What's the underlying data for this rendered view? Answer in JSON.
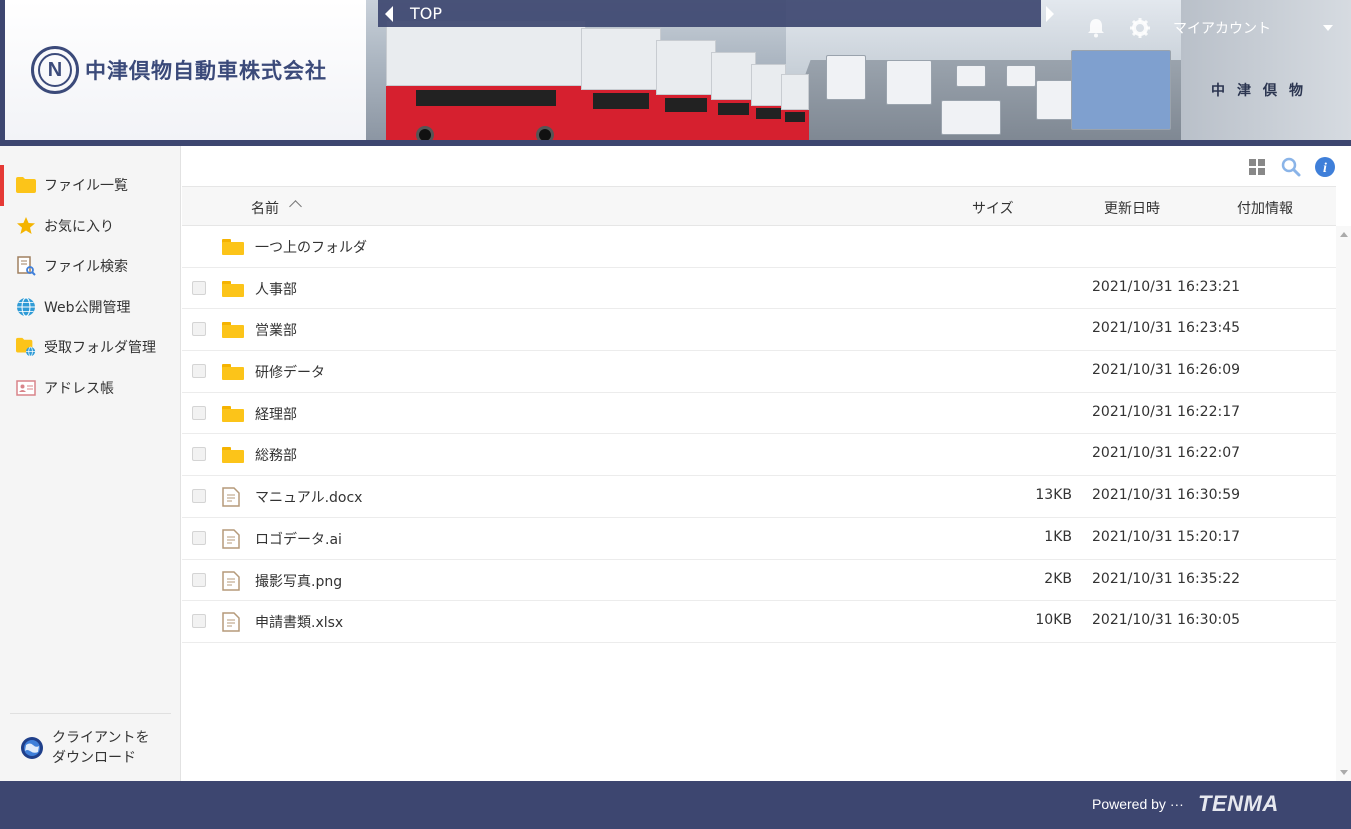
{
  "company": {
    "logo_letter": "N",
    "name": "中津倶物自動車株式会社",
    "banner_sign": "中津倶物"
  },
  "topbar": {
    "title": "TOP"
  },
  "header": {
    "account_label": "マイアカウント"
  },
  "sidebar": {
    "items": [
      {
        "label": "ファイル一覧",
        "icon": "folder-icon",
        "active": true
      },
      {
        "label": "お気に入り",
        "icon": "star-icon",
        "active": false
      },
      {
        "label": "ファイル検索",
        "icon": "file-search-icon",
        "active": false
      },
      {
        "label": "Web公開管理",
        "icon": "globe-icon",
        "active": false
      },
      {
        "label": "受取フォルダ管理",
        "icon": "folder-globe-icon",
        "active": false
      },
      {
        "label": "アドレス帳",
        "icon": "address-card-icon",
        "active": false
      }
    ],
    "client_download": {
      "line1": "クライアントを",
      "line2": "ダウンロード"
    }
  },
  "table": {
    "columns": {
      "name": "名前",
      "size": "サイズ",
      "updated": "更新日時",
      "extra": "付加情報"
    },
    "parent_folder": "一つ上のフォルダ",
    "rows": [
      {
        "type": "folder",
        "name": "人事部",
        "size": "",
        "date": "2021/10/31 16:23:21"
      },
      {
        "type": "folder",
        "name": "営業部",
        "size": "",
        "date": "2021/10/31 16:23:45"
      },
      {
        "type": "folder",
        "name": "研修データ",
        "size": "",
        "date": "2021/10/31 16:26:09"
      },
      {
        "type": "folder",
        "name": "経理部",
        "size": "",
        "date": "2021/10/31 16:22:17"
      },
      {
        "type": "folder",
        "name": "総務部",
        "size": "",
        "date": "2021/10/31 16:22:07"
      },
      {
        "type": "file",
        "name": "マニュアル.docx",
        "size": "13KB",
        "date": "2021/10/31 16:30:59"
      },
      {
        "type": "file",
        "name": "ロゴデータ.ai",
        "size": "1KB",
        "date": "2021/10/31 15:20:17"
      },
      {
        "type": "file",
        "name": "撮影写真.png",
        "size": "2KB",
        "date": "2021/10/31 16:35:22"
      },
      {
        "type": "file",
        "name": "申請書類.xlsx",
        "size": "10KB",
        "date": "2021/10/31 16:30:05"
      }
    ]
  },
  "footer": {
    "powered_by": "Powered by ···",
    "brand": "TENMA"
  },
  "colors": {
    "navy": "#3d4670",
    "active_indicator": "#e53935",
    "folder": "#fcc419",
    "info": "#3f7fd9"
  }
}
